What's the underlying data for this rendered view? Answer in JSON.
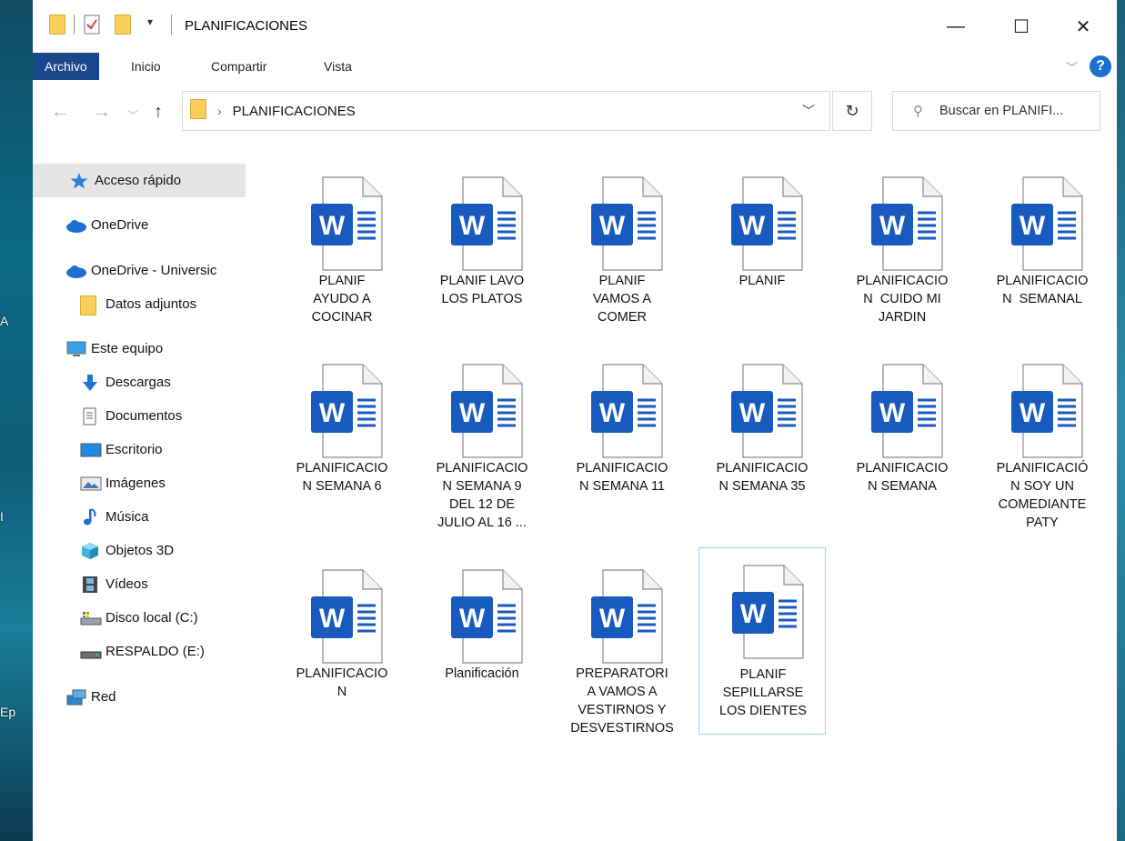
{
  "desktop": {
    "labels": [
      "A",
      "I",
      "Ep"
    ]
  },
  "window": {
    "title": "PLANIFICACIONES",
    "controls": {
      "minimize": "—",
      "maximize": "☐",
      "close": "✕"
    }
  },
  "ribbon": {
    "tabs": [
      "Archivo",
      "Inicio",
      "Compartir",
      "Vista"
    ],
    "active_tab": "Archivo",
    "help": "?"
  },
  "address_bar": {
    "separator": "›",
    "path": "PLANIFICACIONES"
  },
  "search": {
    "placeholder": "Buscar en PLANIFI..."
  },
  "sidebar": {
    "items": [
      {
        "label": "Acceso rápido",
        "icon": "star-icon",
        "selected": true
      },
      {
        "label": "OneDrive",
        "icon": "cloud-icon"
      },
      {
        "label": "OneDrive - Universic",
        "icon": "cloud-icon"
      },
      {
        "label": "Datos adjuntos",
        "icon": "folder-icon"
      },
      {
        "label": "Este equipo",
        "icon": "computer-icon"
      },
      {
        "label": "Descargas",
        "icon": "download-arrow-icon"
      },
      {
        "label": "Documentos",
        "icon": "document-icon"
      },
      {
        "label": "Escritorio",
        "icon": "desktop-icon"
      },
      {
        "label": "Imágenes",
        "icon": "pictures-icon"
      },
      {
        "label": "Música",
        "icon": "music-note-icon"
      },
      {
        "label": "Objetos 3D",
        "icon": "cube-icon"
      },
      {
        "label": "Vídeos",
        "icon": "film-icon"
      },
      {
        "label": "Disco local (C:)",
        "icon": "drive-icon"
      },
      {
        "label": "RESPALDO (E:)",
        "icon": "drive-icon"
      },
      {
        "label": "Red",
        "icon": "network-icon"
      }
    ]
  },
  "files": [
    {
      "name": "PLANIF AYUDO A COCINAR",
      "lines": [
        "PLANIF",
        "AYUDO A",
        "COCINAR"
      ]
    },
    {
      "name": "PLANIF LAVO LOS PLATOS",
      "lines": [
        "PLANIF LAVO",
        "LOS PLATOS"
      ]
    },
    {
      "name": "PLANIF VAMOS A COMER",
      "lines": [
        "PLANIF",
        "VAMOS A",
        "COMER"
      ]
    },
    {
      "name": "PLANIF",
      "lines": [
        "PLANIF"
      ]
    },
    {
      "name": "PLANIFICACION CUIDO MI JARDIN",
      "lines": [
        "PLANIFICACIO",
        "N  CUIDO MI",
        "JARDIN"
      ]
    },
    {
      "name": "PLANIFICACION SEMANAL",
      "lines": [
        "PLANIFICACIO",
        "N  SEMANAL"
      ]
    },
    {
      "name": "PLANIFICACION SEMANA 6",
      "lines": [
        "PLANIFICACIO",
        "N SEMANA 6"
      ]
    },
    {
      "name": "PLANIFICACION SEMANA 9 DEL 12 DE JULIO AL 16 ...",
      "lines": [
        "PLANIFICACIO",
        "N SEMANA 9",
        "DEL 12 DE",
        "JULIO AL 16 ..."
      ]
    },
    {
      "name": "PLANIFICACION SEMANA 11",
      "lines": [
        "PLANIFICACIO",
        "N SEMANA 11"
      ]
    },
    {
      "name": "PLANIFICACION SEMANA 35",
      "lines": [
        "PLANIFICACIO",
        "N SEMANA 35"
      ]
    },
    {
      "name": "PLANIFICACION SEMANA",
      "lines": [
        "PLANIFICACIO",
        "N SEMANA"
      ]
    },
    {
      "name": "PLANIFICACIÓN SOY UN COMEDIANTE PATY",
      "lines": [
        "PLANIFICACIÓ",
        "N SOY UN",
        "COMEDIANTE",
        "PATY"
      ]
    },
    {
      "name": "PLANIFICACION",
      "lines": [
        "PLANIFICACIO",
        "N"
      ]
    },
    {
      "name": "Planificación",
      "lines": [
        "Planificación"
      ]
    },
    {
      "name": "PREPARATORIA VAMOS A VESTIRNOS Y DESVESTIRNOS",
      "lines": [
        "PREPARATORI",
        "A VAMOS A",
        "VESTIRNOS Y",
        "DESVESTIRNOS"
      ]
    },
    {
      "name": "PLANIF SEPILLARSE LOS DIENTES",
      "lines": [
        "PLANIF",
        "SEPILLARSE",
        "LOS DIENTES"
      ],
      "selected": true
    }
  ],
  "colors": {
    "word_blue": "#185abd",
    "ribbon_active": "#19478a",
    "selection_border": "#99d1ff"
  }
}
